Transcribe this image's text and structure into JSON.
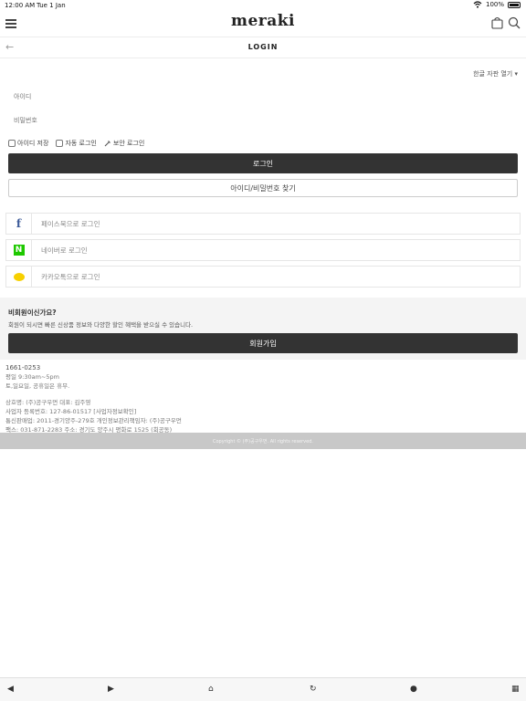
{
  "status": {
    "time": "12:00 AM",
    "date": "Tue 1 Jan",
    "battery": "100%"
  },
  "header": {
    "logo": "meraki"
  },
  "subheader": {
    "title": "LOGIN"
  },
  "login": {
    "keyboard_toggle": "한글 자판 열기 ▾",
    "id_placeholder": "아이디",
    "pw_placeholder": "비밀번호",
    "save_id": "아이디 저장",
    "auto_login": "자동 로그인",
    "secure_login": "보안 로그인",
    "login_button": "로그인",
    "find_button": "아이디/비밀번호 찾기"
  },
  "sns": {
    "facebook": "페이스북으로 로그인",
    "naver": "네이버로 로그인",
    "kakao": "카카오톡으로 로그인"
  },
  "member": {
    "question": "비회원이신가요?",
    "description": "회원이 되시면 빠른 신상품 정보와 다양한 할인 혜택을 받으실 수 있습니다.",
    "join_button": "회원가입"
  },
  "footer": {
    "phone": "1661-0253",
    "hours": "평일 9:30am~5pm",
    "holiday": "토,일요일, 공휴일은 휴무.",
    "company": "상호명: (주)공구우먼   대표: 김주영",
    "business": "사업자 등록번호: 127-86-01517 [사업자정보확인]",
    "commerce": "통신판매업: 2011-경기양주-279호    개인정보관리책임자: (주)공구우먼",
    "fax": "팩스: 031-871-2283    주소: 경기도 양주시 평화로 1525 (회공동)",
    "copyright": "Copyright © (주)공구우먼. All rights reserved."
  }
}
